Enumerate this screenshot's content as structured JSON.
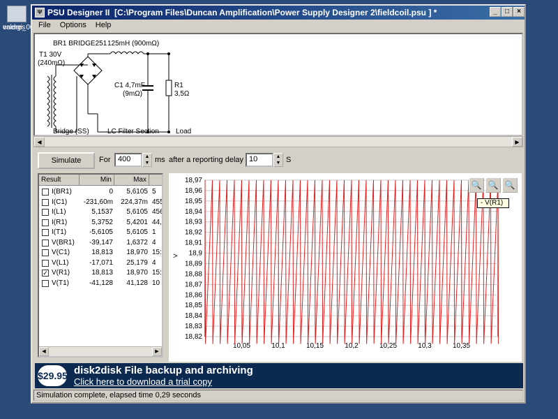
{
  "desktop": {
    "icon_labels": [
      "valdres",
      "energi_00"
    ]
  },
  "window": {
    "app_name": "PSU Designer II",
    "file_path": "[C:\\Program Files\\Duncan Amplification\\Power Supply Designer 2\\fieldcoil.psu ] *"
  },
  "menu": {
    "items": [
      "File",
      "Options",
      "Help"
    ]
  },
  "schematic": {
    "transformer": "T1 30V",
    "transformer_res": "(240mΩ)",
    "rectifier": "BR1 BRIDGE251",
    "inductor": "125mH (900mΩ)",
    "capacitor": "C1 4,7mF",
    "capacitor_res": "(9mΩ)",
    "resistor": "R1",
    "resistor_val": "3,5Ω",
    "section_bridge": "Bridge (SS)",
    "section_lc": "LC Filter Section",
    "section_load": "Load"
  },
  "sim": {
    "button": "Simulate",
    "for_label": "For",
    "duration": "400",
    "duration_unit": "ms",
    "delay_label": "after a reporting delay of",
    "delay": "10",
    "delay_unit": "S"
  },
  "results": {
    "columns": [
      "Result",
      "Min",
      "Max"
    ],
    "rows": [
      {
        "name": "I(BR1)",
        "min": "0",
        "max": "5,6105",
        "extra": "5",
        "checked": false
      },
      {
        "name": "I(C1)",
        "min": "-231,60m",
        "max": "224,37m",
        "extra": "455",
        "checked": false
      },
      {
        "name": "I(L1)",
        "min": "5,1537",
        "max": "5,6105",
        "extra": "456",
        "checked": false
      },
      {
        "name": "I(R1)",
        "min": "5,3752",
        "max": "5,4201",
        "extra": "44,",
        "checked": false
      },
      {
        "name": "I(T1)",
        "min": "-5,6105",
        "max": "5,6105",
        "extra": "1",
        "checked": false
      },
      {
        "name": "V(BR1)",
        "min": "-39,147",
        "max": "1,6372",
        "extra": "4",
        "checked": false
      },
      {
        "name": "V(C1)",
        "min": "18,813",
        "max": "18,970",
        "extra": "15:",
        "checked": false
      },
      {
        "name": "V(L1)",
        "min": "-17,071",
        "max": "25,179",
        "extra": "4",
        "checked": false
      },
      {
        "name": "V(R1)",
        "min": "18,813",
        "max": "18,970",
        "extra": "15:",
        "checked": true
      },
      {
        "name": "V(T1)",
        "min": "-41,128",
        "max": "41,128",
        "extra": "10",
        "checked": false
      }
    ]
  },
  "plot": {
    "legend": "- V(R1)",
    "y_marker": ">",
    "zoom_icons": [
      "zoom-in-icon",
      "zoom-out-icon",
      "zoom-reset-icon"
    ],
    "trace_color": "#e02020"
  },
  "chart_data": {
    "type": "line",
    "title": "",
    "xlabel": "",
    "ylabel": "",
    "xlim": [
      10.0,
      10.4
    ],
    "ylim": [
      18.82,
      18.97
    ],
    "x_ticks": [
      "10,05",
      "10,1",
      "10,15",
      "10,2",
      "10,25",
      "10,3",
      "10,35"
    ],
    "x_tick_values": [
      10.05,
      10.1,
      10.15,
      10.2,
      10.25,
      10.3,
      10.35
    ],
    "y_ticks": [
      "18,97",
      "18,96",
      "18,95",
      "18,94",
      "18,93",
      "18,92",
      "18,91",
      "18,9",
      "18,89",
      "18,88",
      "18,87",
      "18,86",
      "18,85",
      "18,84",
      "18,83",
      "18,82"
    ],
    "y_tick_values": [
      18.97,
      18.96,
      18.95,
      18.94,
      18.93,
      18.92,
      18.91,
      18.9,
      18.89,
      18.88,
      18.87,
      18.86,
      18.85,
      18.84,
      18.83,
      18.82
    ],
    "grid": true,
    "series": [
      {
        "name": "V(R1)",
        "ripple_min": 18.813,
        "ripple_max": 18.97,
        "period": 0.01
      }
    ]
  },
  "banner": {
    "price": "$29.95",
    "headline": "disk2disk File backup and archiving",
    "link": "Click here to download a trial copy"
  },
  "status": {
    "text": "Simulation complete, elapsed time 0,29 seconds"
  }
}
